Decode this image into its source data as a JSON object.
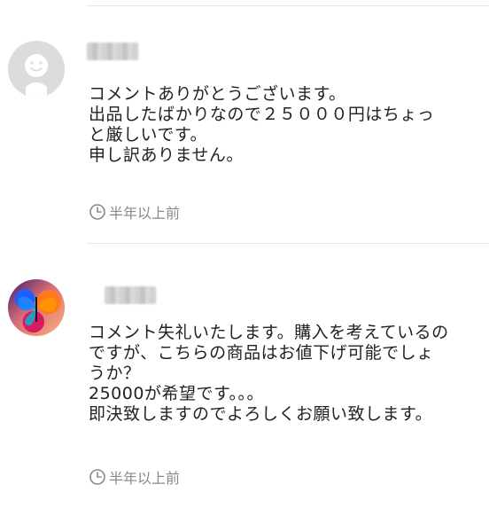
{
  "comments": [
    {
      "avatar": "default-person-icon",
      "username_state": "blurred",
      "lines": [
        "コメントありがとうございます。",
        "出品したばかりなので２５０００円はちょっ",
        "と厳しいです。",
        "申し訳ありません。"
      ],
      "time": "半年以上前",
      "time_icon": "clock-icon"
    },
    {
      "avatar": "butterfly-photo-avatar",
      "username_state": "blurred",
      "lines": [
        "コメント失礼いたします。購入を考えているの",
        "ですが、こちらの商品はお値下げ可能でしょ",
        "うか？",
        "25000が希望です。。。",
        "即決致しますのでよろしくお願い致します。"
      ],
      "time": "半年以上前",
      "time_icon": "clock-icon"
    }
  ],
  "colors": {
    "text": "#222222",
    "meta": "#888888",
    "divider": "#e6e6e6",
    "default_avatar": "#dcdcdc"
  }
}
